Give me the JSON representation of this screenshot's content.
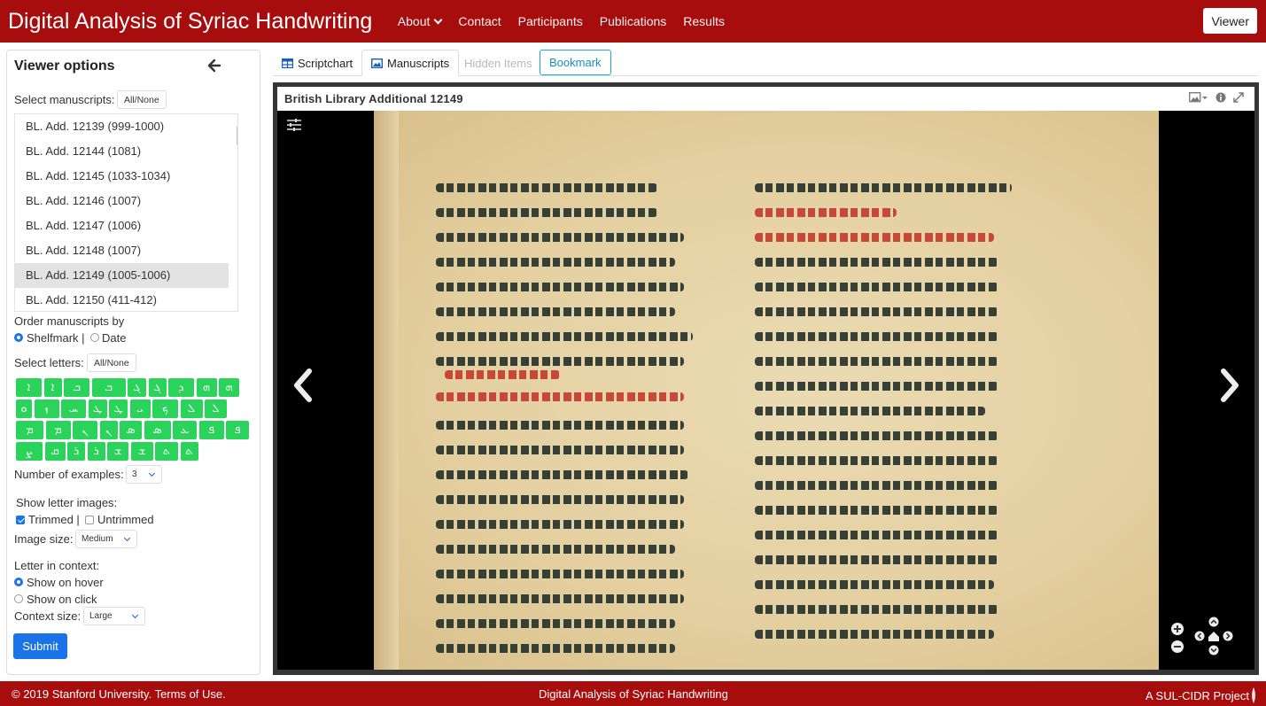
{
  "header": {
    "brand": "Digital Analysis of Syriac Handwriting",
    "nav": [
      "About",
      "Contact",
      "Participants",
      "Publications",
      "Results"
    ],
    "viewer_button": "Viewer"
  },
  "sidebar": {
    "title": "Viewer options",
    "select_manuscripts_label": "Select manuscripts:",
    "all_none": "All/None",
    "manuscripts": [
      "BL. Add. 12139 (999-1000)",
      "BL. Add. 12144 (1081)",
      "BL. Add. 12145 (1033-1034)",
      "BL. Add. 12146 (1007)",
      "BL. Add. 12147 (1006)",
      "BL. Add. 12148 (1007)",
      "BL. Add. 12149 (1005-1006)",
      "BL. Add. 12150 (411-412)"
    ],
    "selected_manuscript": "BL. Add. 12149 (1005-1006)",
    "order_label": "Order manuscripts by",
    "order_shelfmark": "Shelfmark |",
    "order_date": "Date",
    "select_letters_label": "Select letters:",
    "letters_all_none": "All/None",
    "letter_rows": [
      [
        "ܐ",
        "ܐ",
        "ܒ",
        "ܒ",
        "ܓ",
        "ܓ",
        "ܕ",
        "ܗ",
        "ܗ"
      ],
      [
        "ܘ",
        "ܙ",
        "ܚ",
        "ܛ",
        "ܛ",
        "ܝ",
        "ܟ",
        "ܠ",
        "ܠ"
      ],
      [
        "ܡ",
        "ܡ",
        "ܢ",
        "ܢ",
        "ܣ",
        "ܣ",
        "ܥ",
        "ܦ",
        "ܦ"
      ],
      [
        "ܨ",
        "ܩ",
        "ܪ",
        "ܪ",
        "ܫ",
        "ܫ",
        "ܬ",
        "ܬ"
      ]
    ],
    "examples_label": "Number of examples:",
    "examples_value": "3",
    "show_images_label": "Show letter images:",
    "trimmed": "Trimmed |",
    "untrimmed": "Untrimmed",
    "image_size_label": "Image size:",
    "image_size_value": "Medium",
    "context_label": "Letter in context:",
    "show_on_hover": "Show on hover",
    "show_on_click": "Show on click",
    "context_size_label": "Context size:",
    "context_size_value": "Large",
    "submit": "Submit"
  },
  "tabs": [
    {
      "label": "Scriptchart",
      "icon": "table-icon",
      "state": "normal"
    },
    {
      "label": "Manuscripts",
      "icon": "image-icon",
      "state": "active"
    },
    {
      "label": "Hidden Items",
      "icon": "",
      "state": "disabled"
    },
    {
      "label": "Bookmark",
      "icon": "",
      "state": "outlined"
    }
  ],
  "viewer": {
    "title": "British Library Additional 12149",
    "icons": [
      "image-select-icon",
      "info-icon",
      "fullscreen-icon"
    ],
    "controls": [
      "tune-icon",
      "prev-page-icon",
      "next-page-icon",
      "zoom-in-icon",
      "zoom-out-icon",
      "pan-icon",
      "home-icon"
    ]
  },
  "footer": {
    "left": "© 2019 Stanford University. Terms of Use.",
    "middle": "Digital Analysis of Syriac Handwriting",
    "right": "A SUL-CIDR Project"
  },
  "colors": {
    "brand_red": "#a70d0d",
    "letter_green": "#2ad45a",
    "accent_blue": "#1a73e8",
    "bookmark_teal": "#20a8d8"
  }
}
